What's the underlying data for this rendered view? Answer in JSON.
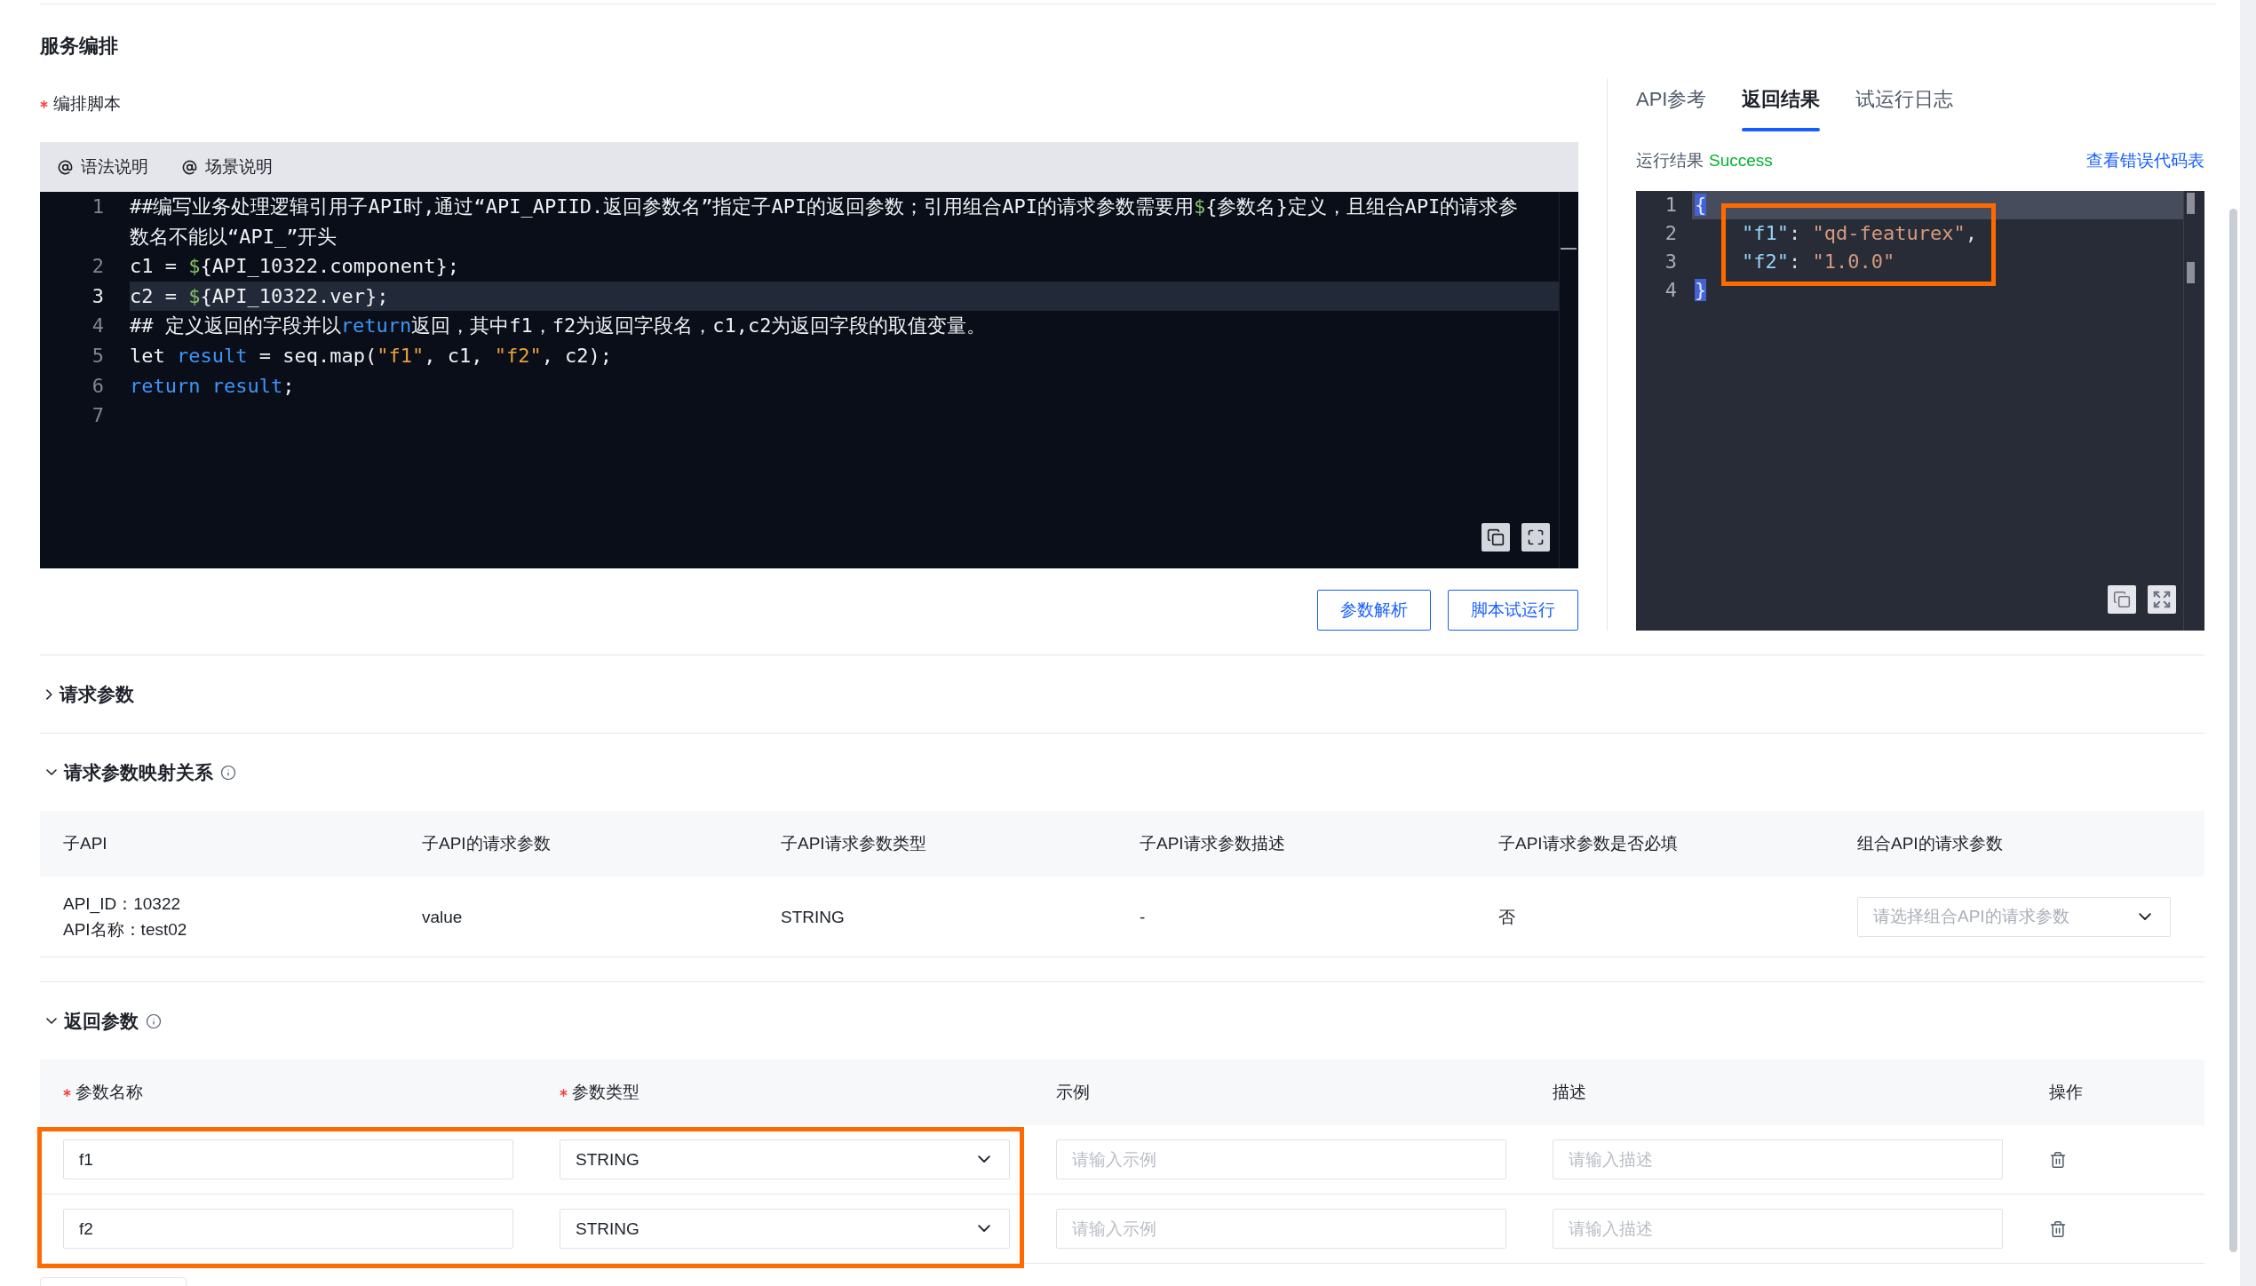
{
  "page_title": "服务编排",
  "script_field": {
    "label": "编排脚本",
    "required": true
  },
  "editor": {
    "toolbar": [
      "语法说明",
      "场景说明"
    ],
    "lines": [
      {
        "number": "1",
        "current": false,
        "tokens": [
          {
            "kind": "plain",
            "text": "##编写业务处理逻辑引用子API时,通过“API_APIID.返回参数名”指定子API的返回参数；引用组合API的请求参数需要用"
          },
          {
            "kind": "symbol",
            "text": "$"
          },
          {
            "kind": "plain",
            "text": "{参数名}定义，且组合API的请求参数名不能以“API_”开头"
          }
        ]
      },
      {
        "number": "2",
        "current": false,
        "tokens": [
          {
            "kind": "plain",
            "text": "c1 = "
          },
          {
            "kind": "symbol",
            "text": "$"
          },
          {
            "kind": "plain",
            "text": "{API_10322.component};"
          }
        ]
      },
      {
        "number": "3",
        "current": true,
        "tokens": [
          {
            "kind": "plain",
            "text": "c2 = "
          },
          {
            "kind": "symbol",
            "text": "$"
          },
          {
            "kind": "plain",
            "text": "{API_10322.ver};"
          }
        ]
      },
      {
        "number": "4",
        "current": false,
        "tokens": [
          {
            "kind": "plain",
            "text": "## 定义返回的字段并以"
          },
          {
            "kind": "keyword",
            "text": "return"
          },
          {
            "kind": "plain",
            "text": "返回，其中f1，f2为返回字段名，c1,c2为返回字段的取值变量。"
          }
        ]
      },
      {
        "number": "5",
        "current": false,
        "tokens": [
          {
            "kind": "plain",
            "text": "let "
          },
          {
            "kind": "keyword",
            "text": "result"
          },
          {
            "kind": "plain",
            "text": " = seq.map("
          },
          {
            "kind": "string",
            "text": "\"f1\""
          },
          {
            "kind": "plain",
            "text": ", c1, "
          },
          {
            "kind": "string",
            "text": "\"f2\""
          },
          {
            "kind": "plain",
            "text": ", c2);"
          }
        ]
      },
      {
        "number": "6",
        "current": false,
        "tokens": [
          {
            "kind": "keyword",
            "text": "return result"
          },
          {
            "kind": "plain",
            "text": ";"
          }
        ]
      },
      {
        "number": "7",
        "current": false
      }
    ]
  },
  "actions": [
    "参数解析",
    "脚本试运行"
  ],
  "result_panel": {
    "tabs": [
      {
        "label": "API参考",
        "selected": false
      },
      {
        "label": "返回结果",
        "selected": true
      },
      {
        "label": "试运行日志",
        "selected": false
      }
    ],
    "status_label": "运行结果",
    "status": "Success",
    "link": "查看错误代码表",
    "lines": [
      {
        "number": "1",
        "current": true,
        "indented": false,
        "highlighted": false,
        "tokens": [
          {
            "kind": "matched-bracket",
            "text": "{"
          }
        ]
      },
      {
        "number": "2",
        "current": false,
        "indented": true,
        "highlighted": true,
        "tokens": [
          {
            "kind": "key",
            "text": "\"f1\""
          },
          {
            "kind": "punct",
            "text": ": "
          },
          {
            "kind": "string",
            "text": "\"qd-featurex\""
          },
          {
            "kind": "punct",
            "text": ","
          }
        ]
      },
      {
        "number": "3",
        "current": false,
        "indented": true,
        "highlighted": true,
        "tokens": [
          {
            "kind": "key",
            "text": "\"f2\""
          },
          {
            "kind": "punct",
            "text": ": "
          },
          {
            "kind": "string",
            "text": "\"1.0.0\""
          }
        ]
      },
      {
        "number": "4",
        "current": false,
        "indented": false,
        "highlighted": false,
        "tokens": [
          {
            "kind": "matched-bracket",
            "text": "}"
          }
        ]
      }
    ]
  },
  "request_params": {
    "title": "请求参数",
    "expanded": false
  },
  "param_mapping": {
    "title": "请求参数映射关系",
    "expanded": true,
    "columns": [
      "子API",
      "子API的请求参数",
      "子API请求参数类型",
      "子API请求参数描述",
      "子API请求参数是否必填",
      "组合API的请求参数"
    ],
    "rows": [
      {
        "sub_api": {
          "id": "API_ID：10322",
          "name": "API名称：test02"
        },
        "request_param": "value",
        "param_type": "STRING",
        "param_description": "-",
        "required": "否",
        "composite_param": {
          "placeholder": "请选择组合API的请求参数"
        }
      }
    ]
  },
  "return_params": {
    "title": "返回参数",
    "expanded": true,
    "columns": [
      {
        "label": "参数名称",
        "required": true
      },
      {
        "label": "参数类型",
        "required": true
      },
      {
        "label": "示例",
        "required": false
      },
      {
        "label": "描述",
        "required": false
      },
      {
        "label": "操作",
        "required": false
      }
    ],
    "rows": [
      {
        "name": "f1",
        "type": "STRING",
        "example": {
          "placeholder": "请输入示例"
        },
        "description": {
          "placeholder": "请输入描述"
        },
        "highlighted": true
      },
      {
        "name": "f2",
        "type": "STRING",
        "example": {
          "placeholder": "请输入示例"
        },
        "description": {
          "placeholder": "请输入描述"
        },
        "highlighted": true
      }
    ]
  }
}
